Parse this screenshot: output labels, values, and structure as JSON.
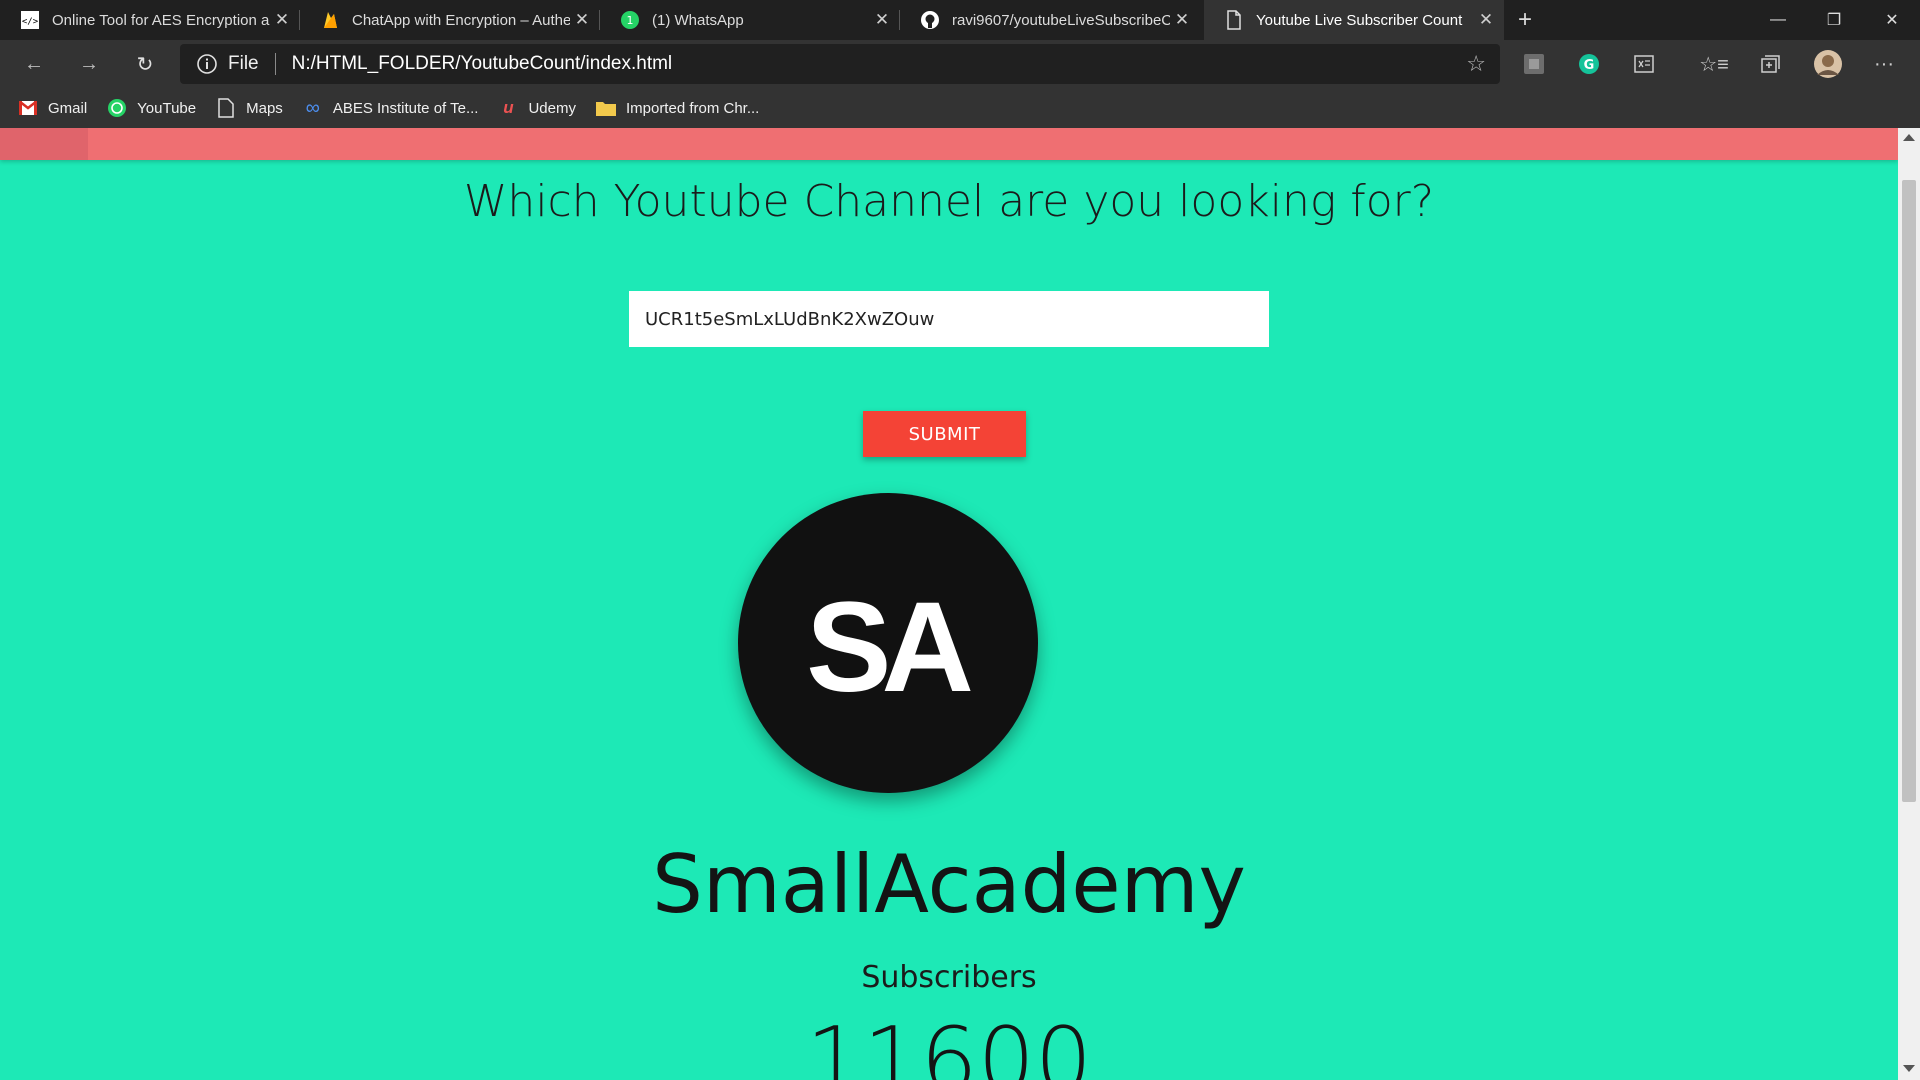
{
  "tabs": [
    {
      "title": "Online Tool for AES Encryption a",
      "icon": "code-icon"
    },
    {
      "title": "ChatApp with Encryption – Authe",
      "icon": "firebase-icon"
    },
    {
      "title": "(1) WhatsApp",
      "icon": "whatsapp-icon"
    },
    {
      "title": "ravi9607/youtubeLiveSubscribeC",
      "icon": "github-icon"
    },
    {
      "title": "Youtube Live Subscriber Count",
      "icon": "page-icon",
      "active": true
    }
  ],
  "address": {
    "scheme_label": "File",
    "url": "N:/HTML_FOLDER/YoutubeCount/index.html"
  },
  "bookmarks": [
    {
      "label": "Gmail",
      "icon": "gmail-icon"
    },
    {
      "label": "YouTube",
      "icon": "whatsapp-icon"
    },
    {
      "label": "Maps",
      "icon": "page-icon"
    },
    {
      "label": "ABES Institute of Te...",
      "icon": "infinity-icon"
    },
    {
      "label": "Udemy",
      "icon": "udemy-icon"
    },
    {
      "label": "Imported from Chr...",
      "icon": "folder-icon"
    }
  ],
  "page": {
    "heading": "Which Youtube Channel are you looking for?",
    "channel_id_value": "UCR1t5eSmLxLUdBnK2XwZOuw",
    "submit_label": "SUBMIT",
    "avatar_text": "SA",
    "channel_name": "SmallAcademy",
    "subscribers_label": "Subscribers",
    "subscribers_count": "11600"
  },
  "colors": {
    "page_background": "#1de9b6",
    "nav_strip": "#ef6f72",
    "submit_button": "#f44336",
    "avatar_background": "#111111"
  }
}
